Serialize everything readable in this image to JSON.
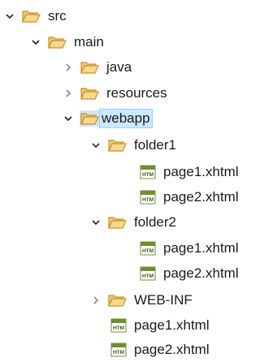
{
  "tree": {
    "src": {
      "label": "src",
      "expanded": true
    },
    "main": {
      "label": "main",
      "expanded": true
    },
    "java": {
      "label": "java",
      "expanded": false
    },
    "resources": {
      "label": "resources",
      "expanded": false
    },
    "webapp": {
      "label": "webapp",
      "expanded": true,
      "selected": true
    },
    "folder1": {
      "label": "folder1",
      "expanded": true,
      "files": [
        {
          "label": "page1.xhtml"
        },
        {
          "label": "page2.xhtml"
        }
      ]
    },
    "folder2": {
      "label": "folder2",
      "expanded": true,
      "files": [
        {
          "label": "page1.xhtml"
        },
        {
          "label": "page2.xhtml"
        }
      ]
    },
    "webinf": {
      "label": "WEB-INF",
      "expanded": false
    },
    "files": [
      {
        "label": "page1.xhtml"
      },
      {
        "label": "page2.xhtml"
      }
    ]
  },
  "icons": {
    "folder": "folder-icon",
    "xhtml": "xhtml-file-icon",
    "expanded": "chevron-down-icon",
    "collapsed": "chevron-right-icon"
  },
  "colors": {
    "folder_fill": "#f6d98b",
    "folder_stroke": "#c8932e",
    "selection_bg": "#cce8ff",
    "selection_border": "#99d1ff",
    "chevron_expanded": "#222222",
    "chevron_collapsed": "#8a8a8a"
  }
}
